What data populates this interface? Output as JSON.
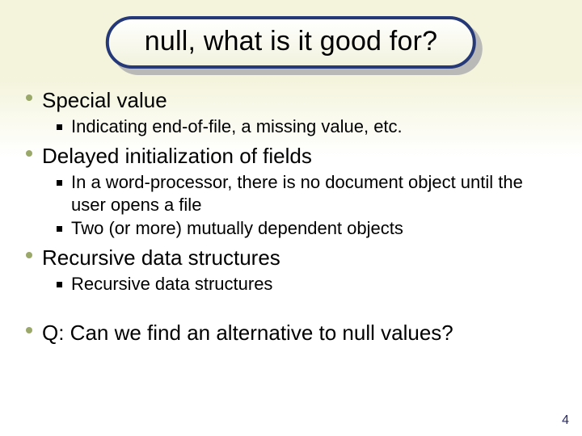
{
  "title": "null, what is it good for?",
  "page_number": "4",
  "bullets": [
    {
      "text": "Special value",
      "sub": [
        "Indicating end-of-file, a missing value, etc."
      ]
    },
    {
      "text": "Delayed initialization of fields",
      "sub": [
        "In a word-processor, there is no document object until the user opens a file",
        "Two (or more) mutually dependent objects"
      ]
    },
    {
      "text": "Recursive data structures",
      "sub": [
        "Recursive data structures"
      ]
    },
    {
      "spacer": true,
      "text": "Q: Can we find an alternative to null values?",
      "sub": []
    }
  ]
}
